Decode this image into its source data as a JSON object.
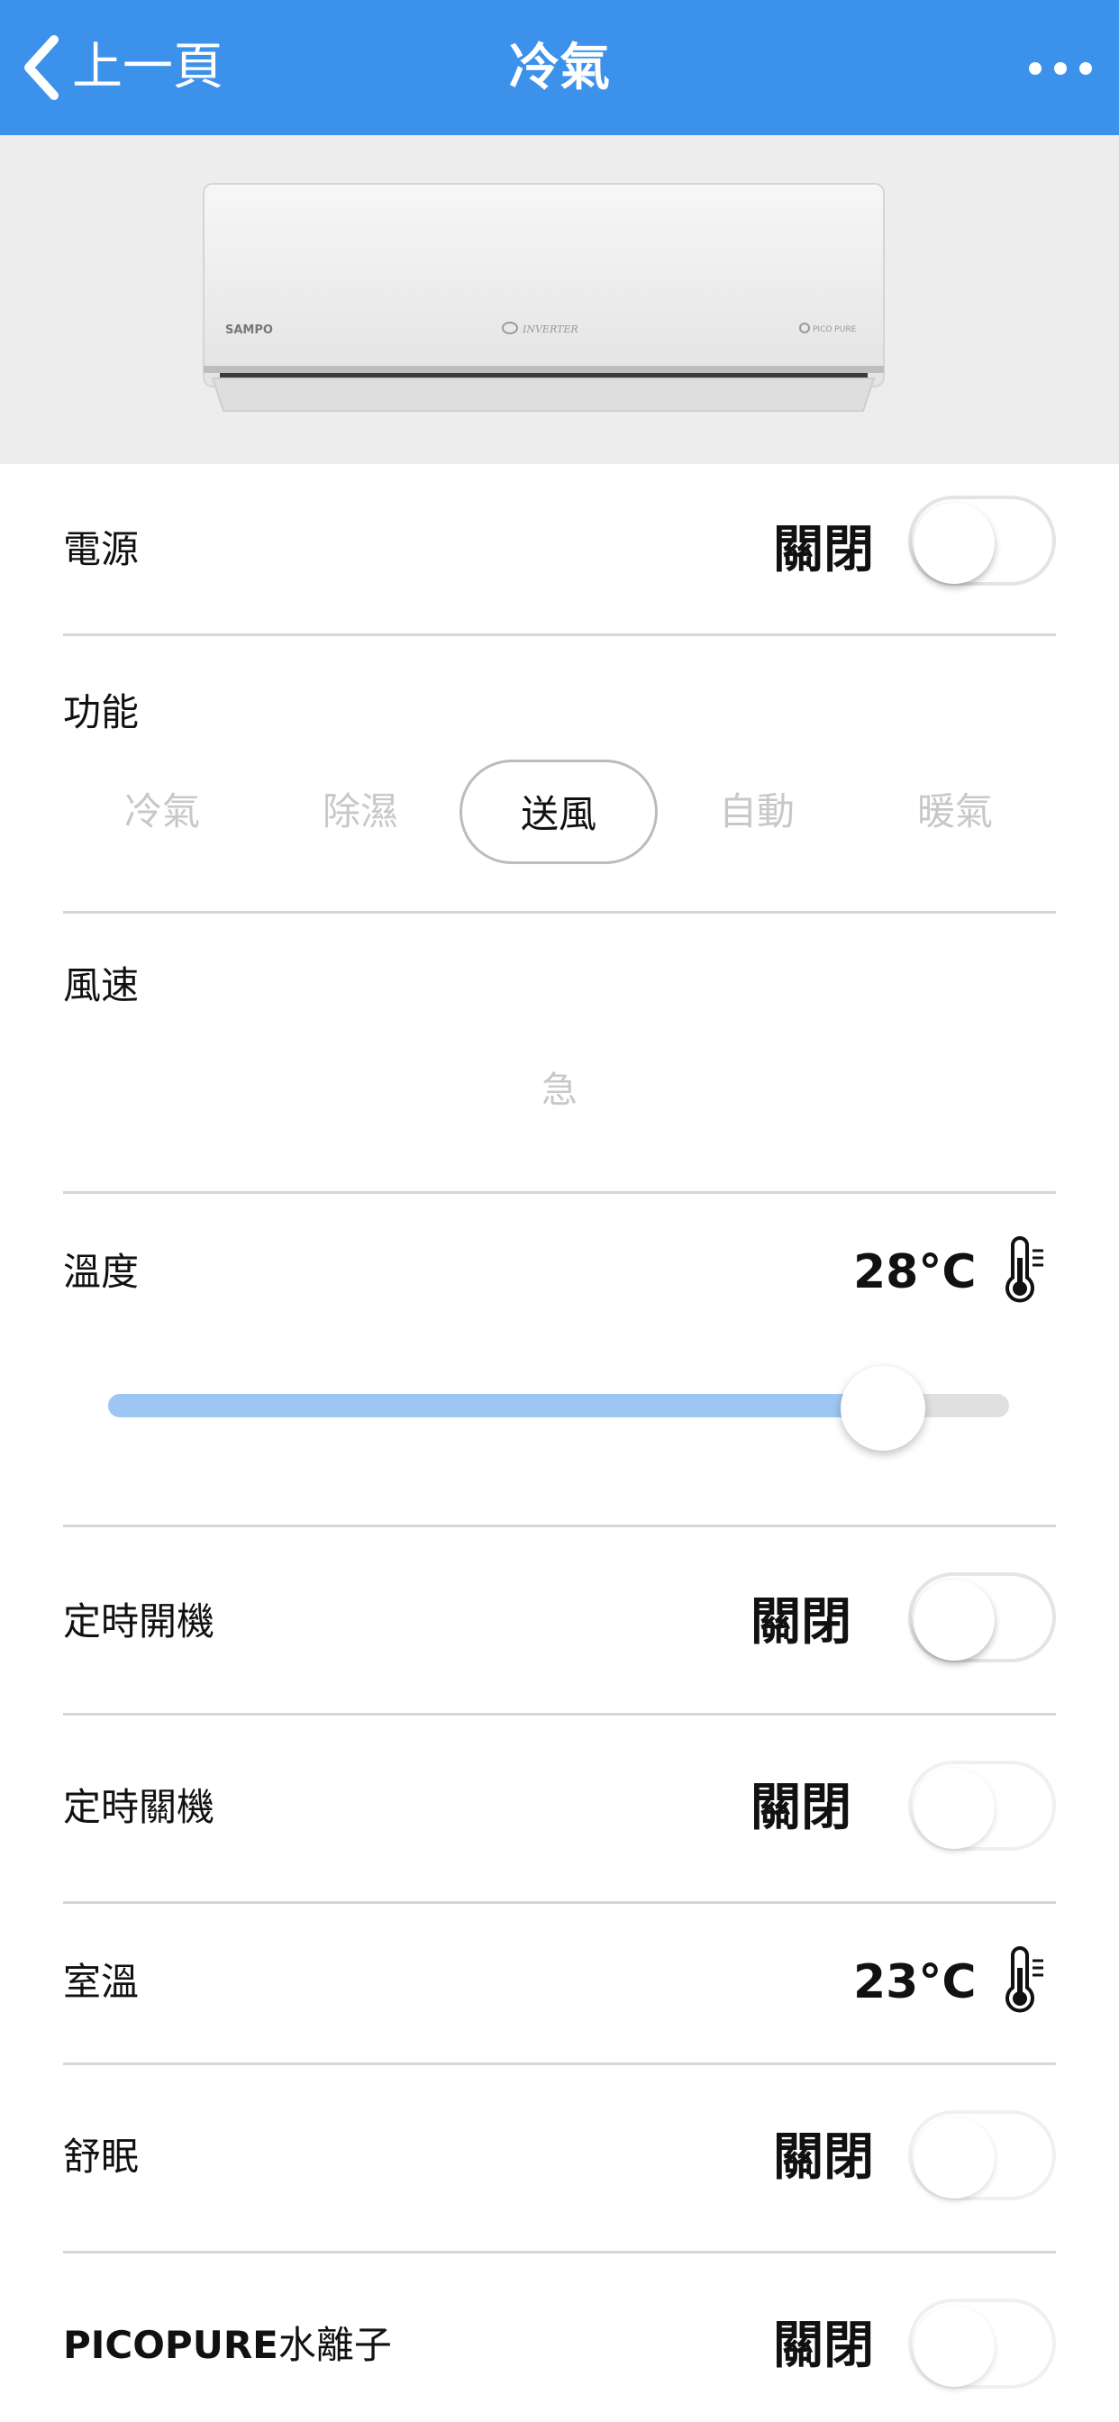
{
  "colors": {
    "accent": "#3c92ea",
    "slider_fill": "#9dc7f2",
    "inactive_text": "#c8c8c8"
  },
  "nav": {
    "back_label": "上一頁",
    "title": "冷氣",
    "back_icon": "chevron-left-icon",
    "more_icon": "more-horizontal-icon"
  },
  "product": {
    "brand": "SAMPO",
    "logo_text": "INVERTER",
    "badge_text": "PICO PURE"
  },
  "power": {
    "label": "電源",
    "status": "關閉",
    "on": false
  },
  "mode": {
    "label": "功能",
    "options": [
      "冷氣",
      "除濕",
      "送風",
      "自動",
      "暖氣"
    ],
    "selected": "送風"
  },
  "fan": {
    "label": "風速",
    "value": "急"
  },
  "temperature": {
    "label": "溫度",
    "display": "28°C",
    "value": 28,
    "slider_fraction": 0.86
  },
  "timer_on": {
    "label": "定時開機",
    "status": "關閉",
    "on": false
  },
  "timer_off": {
    "label": "定時關機",
    "status": "關閉",
    "on": false
  },
  "room_temp": {
    "label": "室溫",
    "display": "23°C"
  },
  "sleep": {
    "label": "舒眠",
    "status": "關閉",
    "on": false
  },
  "picopure": {
    "label_brand": "PICOPURE",
    "label_suffix": "水離子",
    "status": "關閉",
    "on": false
  }
}
